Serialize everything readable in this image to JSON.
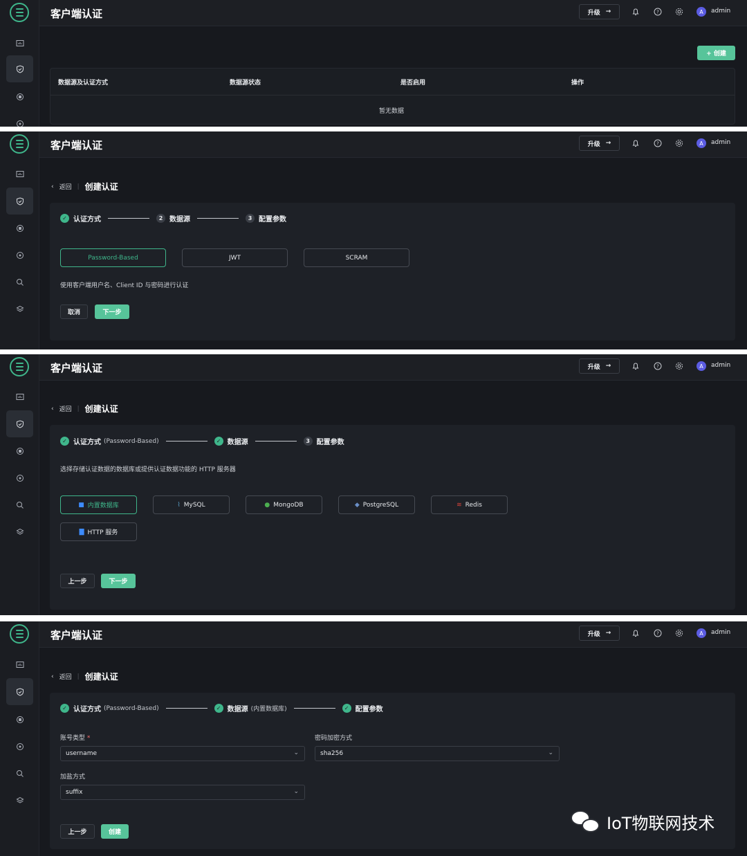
{
  "header": {
    "title": "客户端认证",
    "upgrade_label": "升级",
    "upgrade_arrow": "→",
    "user_avatar": "A",
    "user_name": "admin"
  },
  "panel1": {
    "create_label": "+ 创建",
    "table_headers": [
      "数据源及认证方式",
      "数据源状态",
      "是否启用",
      "操作"
    ],
    "empty_text": "暂无数据"
  },
  "breadcrumb": {
    "back_label": "返回",
    "separator": "|",
    "page_subtitle": "创建认证"
  },
  "steps": {
    "step1_label": "认证方式",
    "step2_label": "数据源",
    "step3_label": "配置参数",
    "step2_num": "2",
    "step3_num": "3",
    "step1_note": "(Password-Based)",
    "step2_note": "(内置数据库)"
  },
  "panel2": {
    "options": [
      "Password-Based",
      "JWT",
      "SCRAM"
    ],
    "selected": "Password-Based",
    "description": "使用客户端用户名、Client ID 与密码进行认证",
    "cancel_label": "取消",
    "next_label": "下一步"
  },
  "panel3": {
    "description": "选择存储认证数据的数据库或提供认证数据功能的 HTTP 服务器",
    "sources": [
      "内置数据库",
      "MySQL",
      "MongoDB",
      "PostgreSQL",
      "Redis",
      "HTTP 服务"
    ],
    "selected": "内置数据库",
    "prev_label": "上一步",
    "next_label": "下一步"
  },
  "panel4": {
    "account_type_label": "账号类型",
    "required_mark": "*",
    "account_type_value": "username",
    "password_hash_label": "密码加密方式",
    "password_hash_value": "sha256",
    "salt_label": "加盐方式",
    "salt_value": "suffix",
    "prev_label": "上一步",
    "create_label": "创建"
  },
  "watermark": {
    "text": "IoT物联网技术"
  },
  "colors": {
    "accent": "#3fb68b",
    "primary_button": "#57c49a",
    "background": "#17191e",
    "card": "#1e2127"
  }
}
